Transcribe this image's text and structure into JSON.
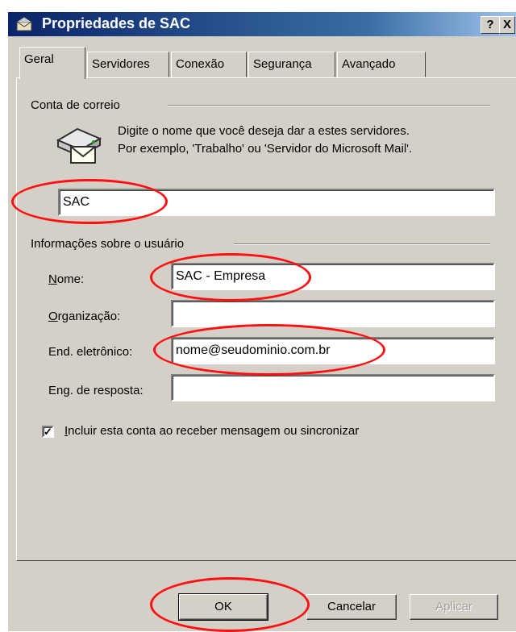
{
  "window": {
    "title": "Propriedades de SAC",
    "help_button": "?",
    "close_button": "X"
  },
  "tabs": [
    {
      "label": "Geral",
      "active": true
    },
    {
      "label": "Servidores",
      "active": false
    },
    {
      "label": "Conexão",
      "active": false
    },
    {
      "label": "Segurança",
      "active": false
    },
    {
      "label": "Avançado",
      "active": false
    }
  ],
  "mail_account": {
    "group_label": "Conta de correio",
    "description_line1": "Digite o nome que você deseja dar a estes servidores.",
    "description_line2": "Por exemplo, 'Trabalho' ou 'Servidor do Microsoft Mail'.",
    "account_name_value": "SAC",
    "icon": "mail-server-icon"
  },
  "user_info": {
    "group_label": "Informações sobre o usuário",
    "name_label": "Nome:",
    "name_value": "SAC - Empresa",
    "organization_label": "Organização:",
    "organization_value": "",
    "email_label": "End. eletrônico:",
    "email_value": "nome@seudominio.com.br",
    "reply_label": "End. de resposta:",
    "reply_value": ""
  },
  "include_checkbox": {
    "label": "Incluir esta conta ao receber mensagem ou sincronizar",
    "checked": true
  },
  "buttons": {
    "ok": "OK",
    "cancel": "Cancelar",
    "apply": "Aplicar"
  },
  "annotation_color": "#ff1010"
}
